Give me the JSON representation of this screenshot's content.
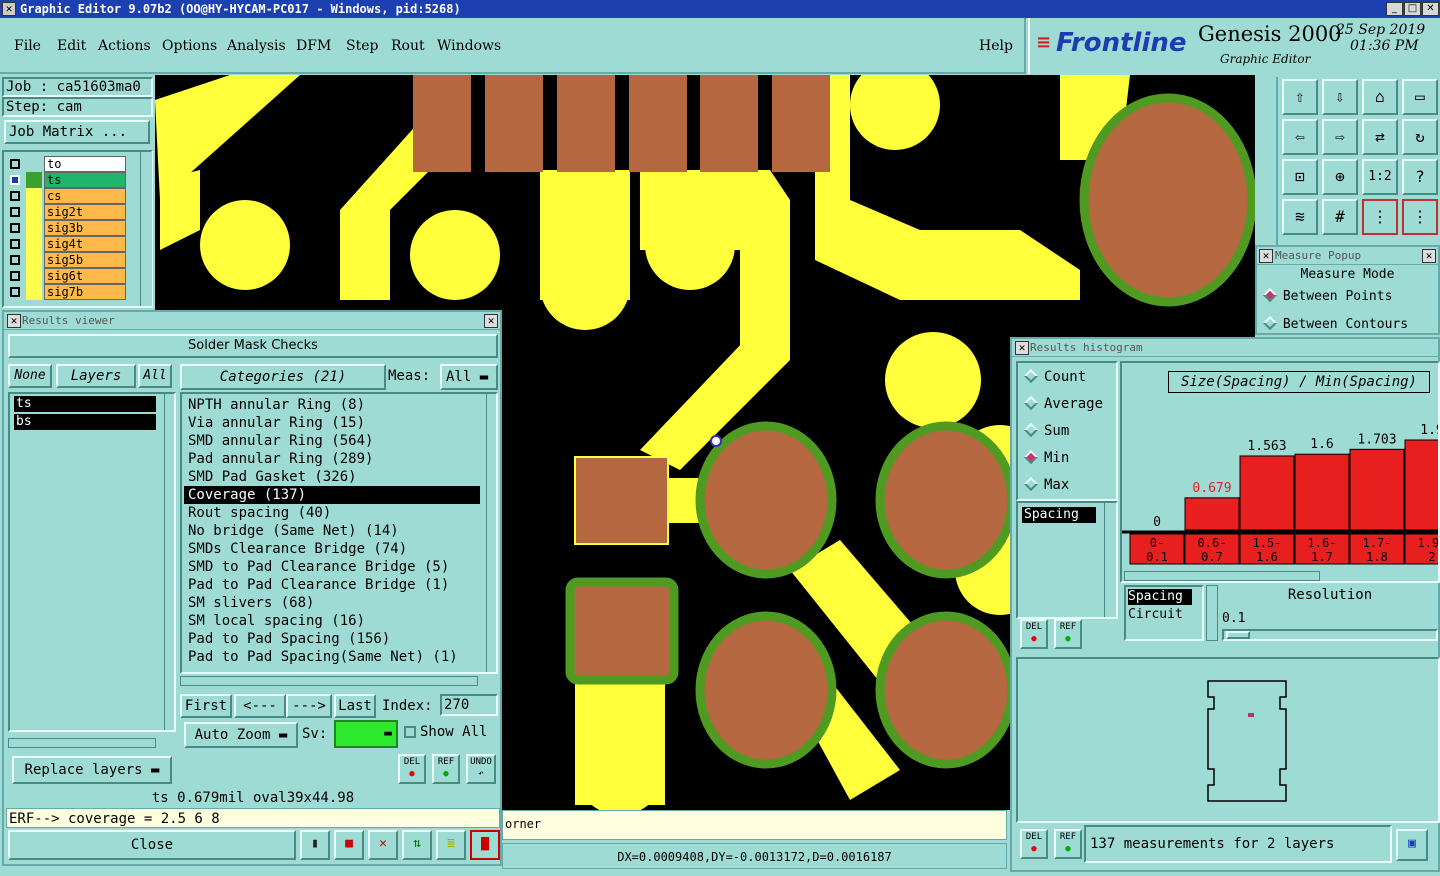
{
  "window": {
    "title": "Graphic Editor 9.07b2 (OO@HY-HYCAM-PC017 - Windows, pid:5268)",
    "min": "_",
    "max": "□",
    "close": "✕"
  },
  "menu": {
    "items": [
      "File",
      "Edit",
      "Actions",
      "Options",
      "Analysis",
      "DFM",
      "Step",
      "Rout",
      "Windows"
    ],
    "help": "Help"
  },
  "brand": {
    "logo": "Frontline",
    "product": "Genesis 2000",
    "sub": "Graphic Editor",
    "date": "25 Sep 2019",
    "time": "01:36 PM"
  },
  "job": {
    "job": "Job : ca51603ma0",
    "step": "Step: cam",
    "matrix": "Job Matrix ..."
  },
  "layers": [
    {
      "name": "to",
      "state": "white"
    },
    {
      "name": "ts",
      "state": "green"
    },
    {
      "name": "cs",
      "state": "orange"
    },
    {
      "name": "sig2t",
      "state": "orange"
    },
    {
      "name": "sig3b",
      "state": "orange"
    },
    {
      "name": "sig4t",
      "state": "orange"
    },
    {
      "name": "sig5b",
      "state": "orange"
    },
    {
      "name": "sig6t",
      "state": "orange"
    },
    {
      "name": "sig7b",
      "state": "orange"
    }
  ],
  "results_viewer": {
    "title": "Results viewer",
    "header": "Solder Mask Checks",
    "none": "None",
    "layers": "Layers",
    "all": "All",
    "categories": "Categories (21)",
    "meas_label": "Meas:",
    "meas_value": "All",
    "layer_list": [
      "ts",
      "bs"
    ],
    "items": [
      "NPTH annular Ring (8)",
      "Via annular Ring (15)",
      "SMD annular Ring (564)",
      "Pad annular Ring (289)",
      "SMD Pad Gasket (326)",
      "Coverage (137)",
      "Rout spacing (40)",
      "No bridge (Same Net) (14)",
      "SMDs Clearance Bridge (74)",
      "SMD to Pad Clearance Bridge (5)",
      "Pad to Pad Clearance Bridge (1)",
      "SM slivers (68)",
      "SM local spacing (16)",
      "Pad to Pad Spacing (156)",
      "Pad to Pad Spacing(Same Net) (1)"
    ],
    "selected_index": 5,
    "first": "First",
    "prev": "<---",
    "next": "--->",
    "last": "Last",
    "index_label": "Index:",
    "index_value": "270",
    "auto_zoom": "Auto Zoom",
    "sv": "Sv:",
    "show_all": "Show All",
    "replace_layers": "Replace layers",
    "del": "DEL",
    "ref": "REF",
    "undo": "UNDO",
    "status": "ts 0.679mil   oval39x44.98",
    "erf": "ERF--> coverage = 2.5 6 8",
    "close": "Close"
  },
  "canvas": {
    "corner_text": "orner",
    "coords": "DX=0.0009408,DY=-0.0013172,D=0.0016187"
  },
  "measure": {
    "title": "Measure Popup",
    "mode": "Measure Mode",
    "opt1": "Between Points",
    "opt2": "Between Contours"
  },
  "histogram": {
    "title": "Results histogram",
    "options": [
      "Count",
      "Average",
      "Sum",
      "Min",
      "Max"
    ],
    "selected": "Min",
    "chart_title": "Size(Spacing) / Min(Spacing)",
    "spacing": "Spacing",
    "spacing2": "Spacing",
    "circuit": "Circuit",
    "resolution": "Resolution",
    "res_value": "0.1",
    "status": "137 measurements for 2 layers",
    "del": "DEL",
    "ref": "REF"
  },
  "chart_data": {
    "type": "bar",
    "title": "Size(Spacing) / Min(Spacing)",
    "categories": [
      "0-\n0.1",
      "0.6-\n0.7",
      "1.5-\n1.6",
      "1.6-\n1.7",
      "1.7-\n1.8",
      "1.9-\n2"
    ],
    "values": [
      0,
      0.679,
      1.563,
      1.6,
      1.703,
      1.9
    ],
    "labels": [
      "0",
      "0.679",
      "1.563",
      "1.6",
      "1.703",
      "1.9"
    ],
    "bar_color": "#e81f1f",
    "highlight_label_color": "#e81f1f"
  }
}
